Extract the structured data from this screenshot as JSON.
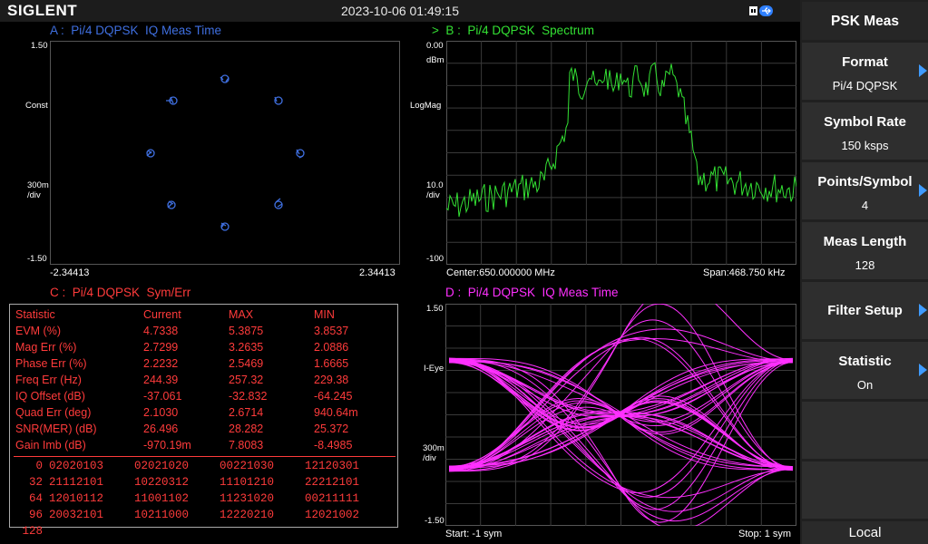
{
  "header": {
    "brand": "SIGLENT",
    "datetime": "2023-10-06 01:49:15",
    "usb_icon": "usb-icon"
  },
  "colors": {
    "blue": "#3f6fe0",
    "green": "#33e033",
    "red": "#ff3b3b",
    "magenta": "#ff30ff",
    "grid": "#3a3a3a",
    "menu_accent": "#3f9bff"
  },
  "pane_a": {
    "title": "A :  Pi/4 DQPSK  IQ Meas Time",
    "y_top": "1.50",
    "y_mode": "Const",
    "y_scale": "300m\n/div",
    "y_bottom": "-1.50",
    "x_left": "-2.34413",
    "x_right": "2.34413"
  },
  "pane_b": {
    "title": ">  B :  Pi/4 DQPSK  Spectrum",
    "y_top": "0.00",
    "y_unit": "dBm",
    "y_mode": "LogMag",
    "y_scale": "10.0\n/div",
    "y_bottom": "-100",
    "center": "Center:650.000000 MHz",
    "span": "Span:468.750 kHz"
  },
  "pane_c": {
    "title": "C :  Pi/4 DQPSK  Sym/Err",
    "headers": [
      "Statistic",
      "Current",
      "MAX",
      "MIN"
    ],
    "rows": [
      [
        "EVM (%)",
        "4.7338",
        "5.3875",
        "3.8537"
      ],
      [
        "Mag Err (%)",
        "2.7299",
        "3.2635",
        "2.0886"
      ],
      [
        "Phase Err (%)",
        "2.2232",
        "2.5469",
        "1.6665"
      ],
      [
        "Freq Err (Hz)",
        "244.39",
        "257.32",
        "229.38"
      ],
      [
        "IQ Offset (dB)",
        "-37.061",
        "-32.832",
        "-64.245"
      ],
      [
        "Quad Err (deg)",
        "2.1030",
        "2.6714",
        "940.64m"
      ],
      [
        "SNR(MER) (dB)",
        "26.496",
        "28.282",
        "25.372"
      ],
      [
        "Gain Imb (dB)",
        "-970.19m",
        "7.8083",
        "-8.4985"
      ]
    ],
    "symbols": [
      [
        "0",
        "02020103",
        "02021020",
        "00221030",
        "12120301"
      ],
      [
        "32",
        "21112101",
        "10220312",
        "11101210",
        "22212101"
      ],
      [
        "64",
        "12010112",
        "11001102",
        "11231020",
        "00211111"
      ],
      [
        "96",
        "20032101",
        "10211000",
        "12220210",
        "12021002"
      ],
      [
        "128",
        "",
        "",
        "",
        ""
      ]
    ]
  },
  "pane_d": {
    "title": "D :  Pi/4 DQPSK  IQ Meas Time",
    "y_top": "1.50",
    "y_mode": "I-Eye",
    "y_scale": "300m\n/div",
    "y_bottom": "-1.50",
    "start": "Start: -1 sym",
    "stop": "Stop: 1 sym"
  },
  "menu": {
    "title": "PSK Meas",
    "items": [
      {
        "label": "Format",
        "value": "Pi/4 DQPSK"
      },
      {
        "label": "Symbol Rate",
        "value": "150 ksps"
      },
      {
        "label": "Points/Symbol",
        "value": "4"
      },
      {
        "label": "Meas Length",
        "value": "128"
      },
      {
        "label": "Filter Setup",
        "value": ""
      },
      {
        "label": "Statistic",
        "value": "On"
      }
    ],
    "local": "Local"
  }
}
